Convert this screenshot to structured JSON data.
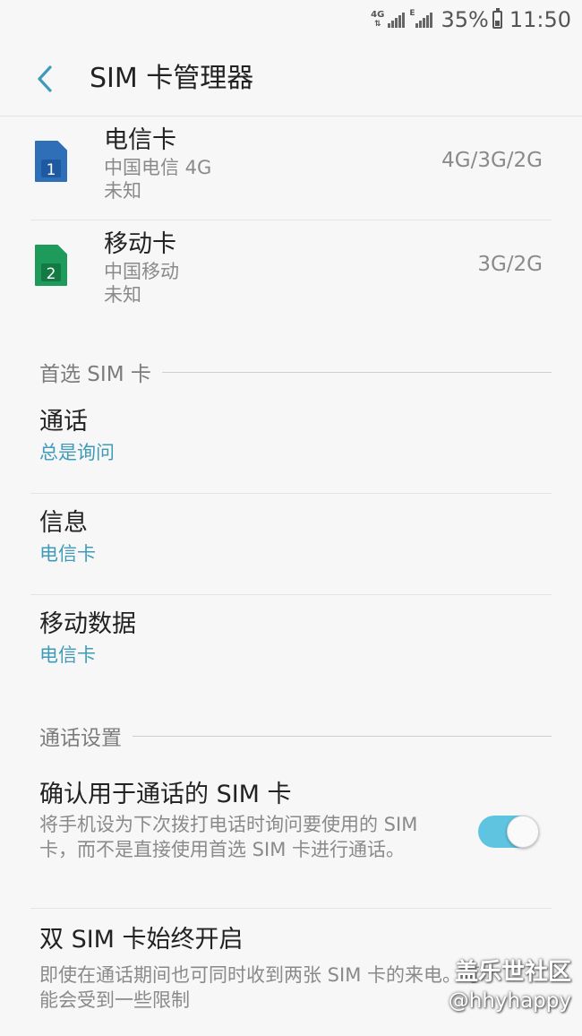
{
  "status_bar": {
    "network": "4G",
    "network_small": "E",
    "battery": "35%",
    "time": "11:50"
  },
  "app_bar": {
    "title": "SIM 卡管理器"
  },
  "sim_cards": [
    {
      "name": "电信卡",
      "carrier": "中国电信 4G",
      "status": "未知",
      "network": "4G/3G/2G",
      "slot": "1",
      "color": "#2f6fb8"
    },
    {
      "name": "移动卡",
      "carrier": "中国移动",
      "status": "未知",
      "network": "3G/2G",
      "slot": "2",
      "color": "#1e9a5a"
    }
  ],
  "preferred_section": {
    "header": "首选 SIM 卡",
    "items": [
      {
        "title": "通话",
        "value": "总是询问"
      },
      {
        "title": "信息",
        "value": "电信卡"
      },
      {
        "title": "移动数据",
        "value": "电信卡"
      }
    ]
  },
  "call_settings": {
    "header": "通话设置",
    "items": [
      {
        "title": "确认用于通话的 SIM 卡",
        "description": "将手机设为下次拨打电话时询问要使用的 SIM 卡，而不是直接使用首选 SIM 卡进行通话。",
        "enabled": true
      },
      {
        "title": "双 SIM 卡始终开启",
        "description": "即使在通话期间也可同时收到两张 SIM 卡的来电。可能会受到一些限制"
      }
    ]
  },
  "watermark": {
    "title": "盖乐世社区",
    "user": "@hhyhappy"
  },
  "colors": {
    "accent": "#3f9bb9",
    "toggle_on": "#5fc4e0"
  }
}
